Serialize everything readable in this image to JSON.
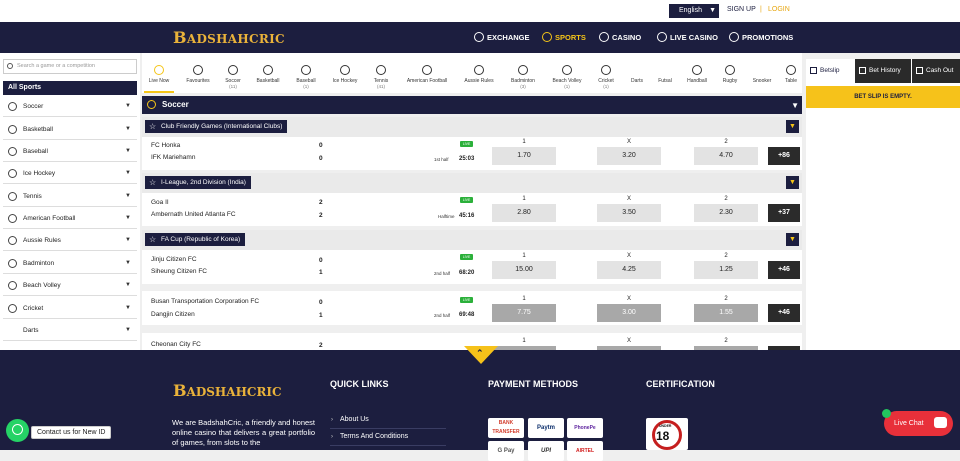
{
  "topbar": {
    "language": "English",
    "signup": "SIGN UP",
    "separator": "|",
    "login": "LOGIN"
  },
  "brand": {
    "logo_initial": "B",
    "logo_rest": "ADSHAHCRIC"
  },
  "nav": [
    {
      "label": "EXCHANGE",
      "icon": "exchange-icon"
    },
    {
      "label": "SPORTS",
      "icon": "sports-icon",
      "active": true
    },
    {
      "label": "CASINO",
      "icon": "casino-icon"
    },
    {
      "label": "LIVE CASINO",
      "icon": "live-casino-icon"
    },
    {
      "label": "PROMOTIONS",
      "icon": "promotions-icon"
    }
  ],
  "sidebar": {
    "search_placeholder": "Search a game or a competition",
    "heading": "All Sports",
    "items": [
      "Soccer",
      "Basketball",
      "Baseball",
      "Ice Hockey",
      "Tennis",
      "American Football",
      "Aussie Rules",
      "Badminton",
      "Beach Volley",
      "Cricket",
      "Darts"
    ]
  },
  "sportbar": [
    {
      "label": "Live Now",
      "count": ""
    },
    {
      "label": "Favourites",
      "count": ""
    },
    {
      "label": "Soccer",
      "count": "(11)"
    },
    {
      "label": "Basketball",
      "count": ""
    },
    {
      "label": "Baseball",
      "count": "(1)"
    },
    {
      "label": "Ice Hockey",
      "count": ""
    },
    {
      "label": "Tennis",
      "count": "(41)"
    },
    {
      "label": "American Football",
      "count": ""
    },
    {
      "label": "Aussie Rules",
      "count": ""
    },
    {
      "label": "Badminton",
      "count": "(3)"
    },
    {
      "label": "Beach Volley",
      "count": "(1)"
    },
    {
      "label": "Cricket",
      "count": "(1)"
    },
    {
      "label": "Darts",
      "count": ""
    },
    {
      "label": "Futsal",
      "count": ""
    },
    {
      "label": "Handball",
      "count": ""
    },
    {
      "label": "Rugby",
      "count": ""
    },
    {
      "label": "Snooker",
      "count": ""
    },
    {
      "label": "Table",
      "count": ""
    }
  ],
  "section": {
    "title": "Soccer"
  },
  "odds_headers": [
    "1",
    "X",
    "2"
  ],
  "live_badge": "LIVE",
  "competitions": [
    {
      "name": "Club Friendly Games (International Clubs)"
    },
    {
      "name": "I-League, 2nd Division (India)"
    },
    {
      "name": "FA Cup (Republic of Korea)"
    }
  ],
  "matches": [
    {
      "home": "FC Honka",
      "away": "IFK Mariehamn",
      "home_score": "0",
      "away_score": "0",
      "phase": "1st half",
      "clock": "25:03",
      "odds": [
        "1.70",
        "3.20",
        "4.70"
      ],
      "more": "+86"
    },
    {
      "home": "Goa II",
      "away": "Ambernath United Atlanta FC",
      "home_score": "2",
      "away_score": "2",
      "phase": "Halftime",
      "clock": "45:16",
      "odds": [
        "2.80",
        "3.50",
        "2.30"
      ],
      "more": "+37"
    },
    {
      "home": "Jinju Citizen FC",
      "away": "Siheung Citizen FC",
      "home_score": "0",
      "away_score": "1",
      "phase": "2nd half",
      "clock": "68:20",
      "odds": [
        "15.00",
        "4.25",
        "1.25"
      ],
      "more": "+46"
    },
    {
      "home": "Busan Transportation Corporation FC",
      "away": "Dangjin Citizen",
      "home_score": "0",
      "away_score": "1",
      "phase": "2nd half",
      "clock": "69:48",
      "odds": [
        "7.75",
        "3.00",
        "1.55"
      ],
      "more": "+46"
    },
    {
      "home": "Cheonan City FC",
      "away": "",
      "home_score": "2",
      "away_score": "",
      "phase": "",
      "clock": "",
      "odds": [
        "",
        "",
        ""
      ],
      "more": ""
    }
  ],
  "betslip": {
    "tabs": [
      "Betslip",
      "Bet History",
      "Cash Out"
    ],
    "empty": "BET SLIP IS EMPTY."
  },
  "footer": {
    "about": "We are BadshahCric, a friendly and honest online casino that delivers a great portfolio of games, from slots to the",
    "quick_links_title": "QUICK LINKS",
    "quick_links": [
      "About Us",
      "Terms And Conditions"
    ],
    "payment_title": "PAYMENT METHODS",
    "payments": [
      "BANK TRANSFER",
      "Paytm",
      "PhonePe",
      "G Pay",
      "UPI",
      "AIRTEL"
    ],
    "certification_title": "CERTIFICATION",
    "cert_label": "18",
    "cert_under": "UNDER"
  },
  "whatsapp": {
    "label": "Contact us for New ID"
  },
  "livechat": {
    "label": "Live Chat"
  },
  "colors": {
    "navy": "#1c1e3f",
    "gold": "#f5c518",
    "live_green": "#2bb03a",
    "chat_red": "#e8303a"
  }
}
